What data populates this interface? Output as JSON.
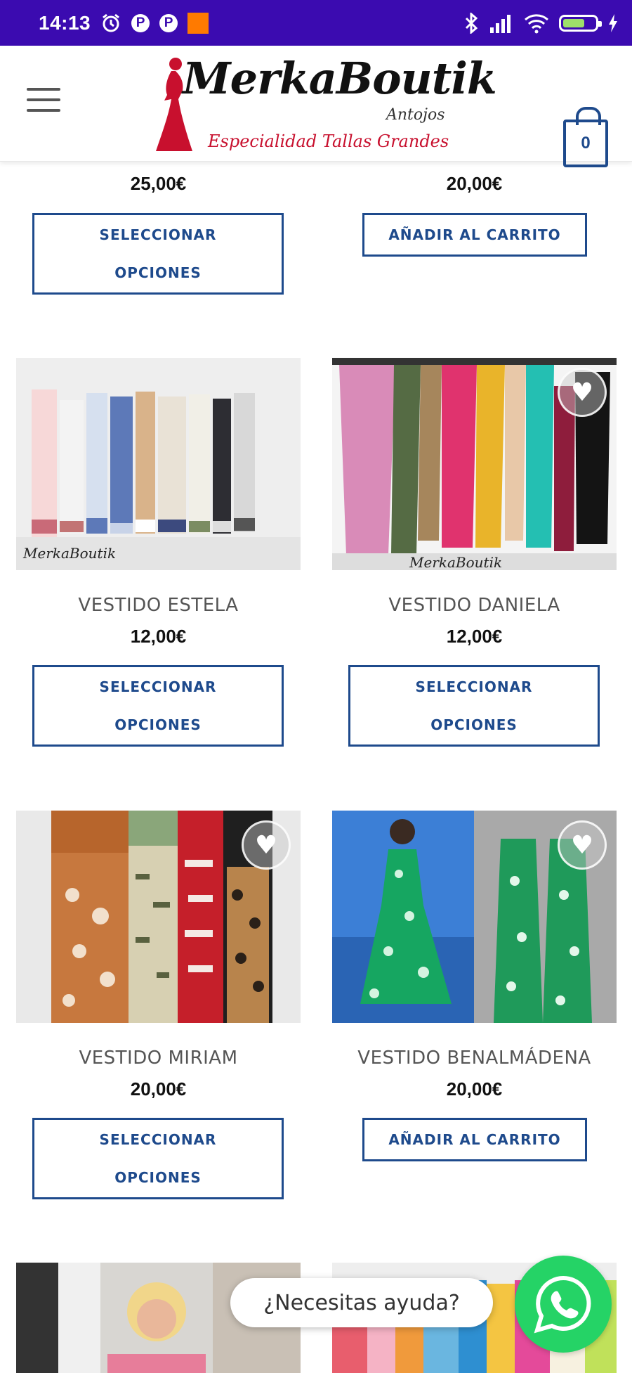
{
  "status_bar": {
    "time": "14:13",
    "p1": "P",
    "p2": "P",
    "battery": "80"
  },
  "header": {
    "logo_title": "MerkaBoutik",
    "logo_subtitle": "Antojos",
    "logo_tagline": "Especialidad Tallas Grandes",
    "cart_count": "0"
  },
  "products": [
    {
      "name": "",
      "price": "25,00€",
      "button": "SELECCIONAR OPCIONES"
    },
    {
      "name": "",
      "price": "20,00€",
      "button": "AÑADIR AL CARRITO"
    },
    {
      "name": "VESTIDO ESTELA",
      "price": "12,00€",
      "button": "SELECCIONAR OPCIONES"
    },
    {
      "name": "VESTIDO DANIELA",
      "price": "12,00€",
      "button": "SELECCIONAR OPCIONES"
    },
    {
      "name": "VESTIDO MIRIAM",
      "price": "20,00€",
      "button": "SELECCIONAR OPCIONES"
    },
    {
      "name": "VESTIDO BENALMÁDENA",
      "price": "20,00€",
      "button": "AÑADIR AL CARRITO"
    }
  ],
  "whatsapp": {
    "bubble": "¿Necesitas ayuda?"
  }
}
